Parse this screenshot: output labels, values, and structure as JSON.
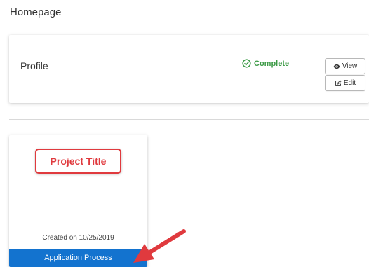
{
  "page": {
    "title": "Homepage"
  },
  "profile_card": {
    "label": "Profile",
    "status": {
      "text": "Complete",
      "icon": "check-circle-icon",
      "color": "#3c9a46"
    },
    "buttons": {
      "view_label": "View",
      "view_icon": "eye-icon",
      "edit_label": "Edit",
      "edit_icon": "edit-icon"
    }
  },
  "project_card": {
    "title": "Project Title",
    "created_on": "Created on 10/25/2019",
    "action_label": "Application Process",
    "action_color": "#1373cf"
  },
  "annotation": {
    "highlight_color": "#e03a3e"
  }
}
